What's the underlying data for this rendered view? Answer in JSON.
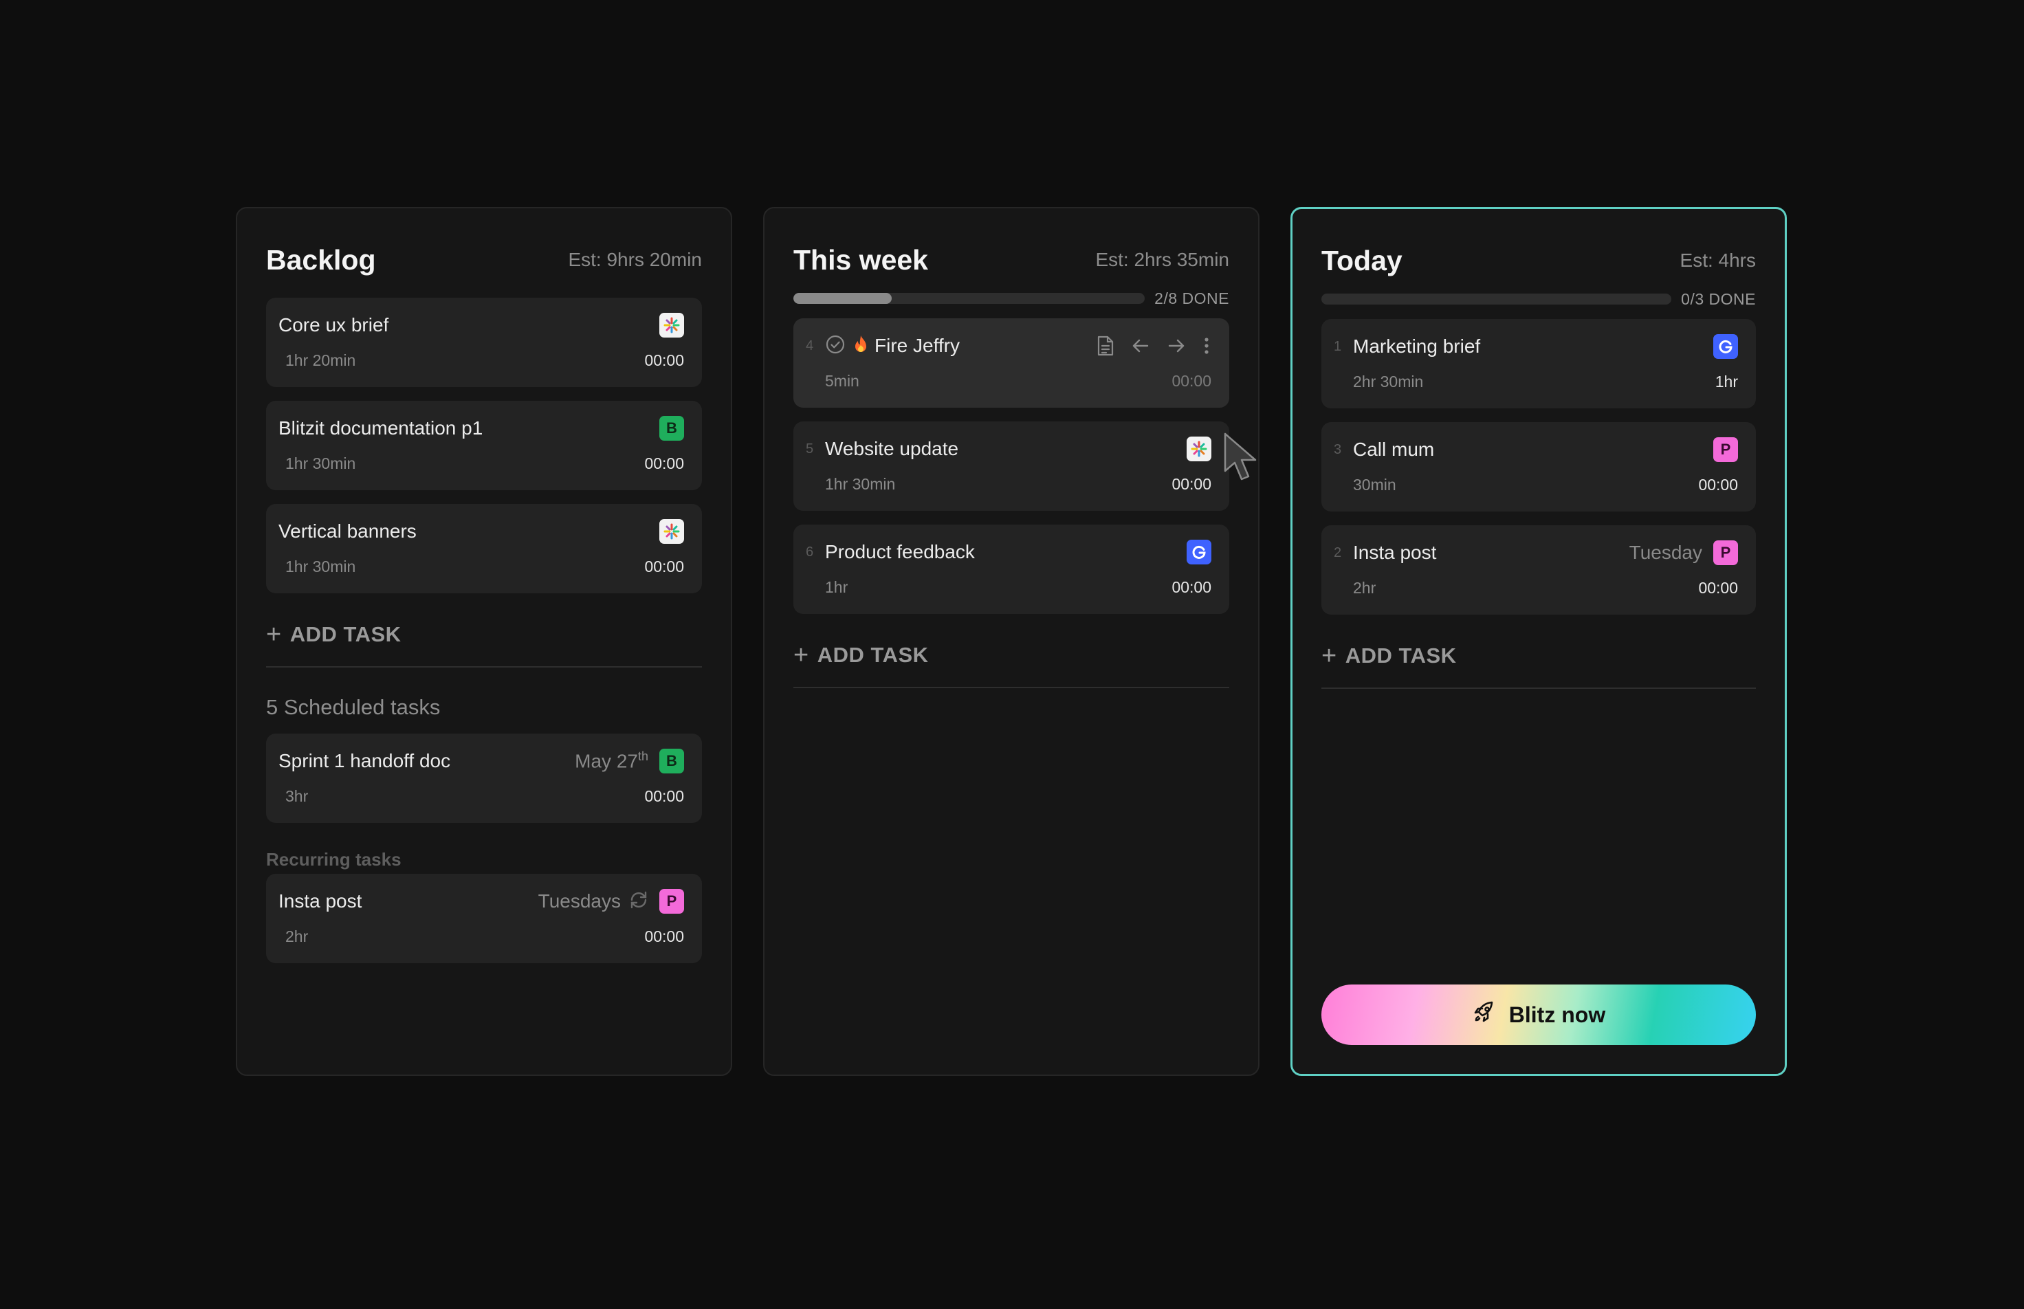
{
  "columns": {
    "backlog": {
      "title": "Backlog",
      "est": "Est: 9hrs 20min",
      "tasks": [
        {
          "title": "Core ux brief",
          "est": "1hr 20min",
          "time": "00:00",
          "badge": "flower-icon"
        },
        {
          "title": "Blitzit documentation p1",
          "est": "1hr 30min",
          "time": "00:00",
          "badge": "B"
        },
        {
          "title": "Vertical banners",
          "est": "1hr 30min",
          "time": "00:00",
          "badge": "flower-icon"
        }
      ],
      "add_task": "ADD TASK",
      "scheduled_title": "5 Scheduled tasks",
      "scheduled": {
        "title": "Sprint 1 handoff doc",
        "date": "May 27",
        "date_suffix": "th",
        "est": "3hr",
        "time": "00:00",
        "badge": "B"
      },
      "recurring_title": "Recurring tasks",
      "recurring": {
        "title": "Insta post",
        "repeat": "Tuesdays",
        "est": "2hr",
        "time": "00:00",
        "badge": "P"
      }
    },
    "week": {
      "title": "This week",
      "est": "Est: 2hrs 35min",
      "progress_label": "2/8 DONE",
      "progress": 0.28,
      "tasks": [
        {
          "num": "4",
          "title": "Fire Jeffry",
          "est": "5min",
          "time": "00:00"
        },
        {
          "num": "5",
          "title": "Website update",
          "est": "1hr 30min",
          "time": "00:00",
          "badge": "flower-icon"
        },
        {
          "num": "6",
          "title": "Product feedback",
          "est": "1hr",
          "time": "00:00",
          "badge": "G"
        }
      ],
      "add_task": "ADD TASK"
    },
    "today": {
      "title": "Today",
      "est": "Est: 4hrs",
      "progress_label": "0/3 DONE",
      "progress": 0,
      "tasks": [
        {
          "num": "1",
          "title": "Marketing brief",
          "est": "2hr 30min",
          "time": "1hr",
          "badge": "G"
        },
        {
          "num": "3",
          "title": "Call mum",
          "est": "30min",
          "time": "00:00",
          "badge": "P"
        },
        {
          "num": "2",
          "title": "Insta post",
          "meta": "Tuesday",
          "est": "2hr",
          "time": "00:00",
          "badge": "P"
        }
      ],
      "add_task": "ADD TASK",
      "blitz_label": "Blitz now"
    }
  },
  "colors": {
    "accent_border": "#5fd0c4",
    "badge_green": "#1fae5c",
    "badge_pink": "#f36ad9",
    "badge_blue": "#3f62ff"
  }
}
